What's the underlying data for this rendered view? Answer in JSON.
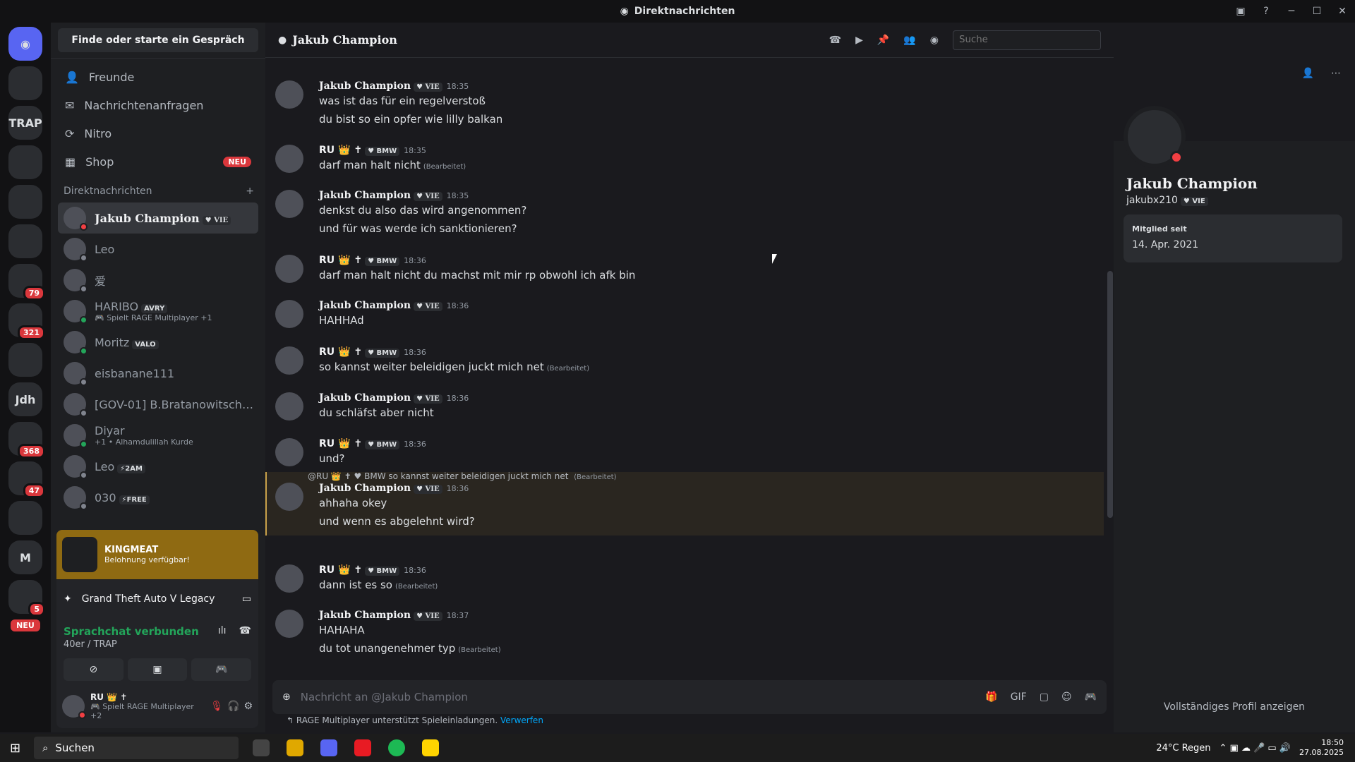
{
  "window": {
    "title": "Direktnachrichten"
  },
  "servers": [
    {
      "label": "",
      "badge": ""
    },
    {
      "label": "TRAP",
      "badge": ""
    },
    {
      "label": "",
      "badge": ""
    },
    {
      "label": "",
      "badge": ""
    },
    {
      "label": "",
      "badge": ""
    },
    {
      "label": "",
      "badge": "79"
    },
    {
      "label": "",
      "badge": "321"
    },
    {
      "label": "",
      "badge": ""
    },
    {
      "label": "Jdh",
      "badge": ""
    },
    {
      "label": "",
      "badge": "368"
    },
    {
      "label": "",
      "badge": "47"
    },
    {
      "label": "",
      "badge": ""
    },
    {
      "label": "M",
      "badge": ""
    },
    {
      "label": "",
      "badge": "5"
    }
  ],
  "servers_neu": "NEU",
  "dm": {
    "search": "Finde oder starte ein Gespräch",
    "nav": [
      {
        "label": "Freunde",
        "icon": "friends-icon"
      },
      {
        "label": "Nachrichtenanfragen",
        "icon": "mail-icon"
      },
      {
        "label": "Nitro",
        "icon": "nitro-icon"
      },
      {
        "label": "Shop",
        "icon": "shop-icon",
        "badge": "NEU"
      }
    ],
    "header": "Direktnachrichten",
    "add": "+",
    "items": [
      {
        "name": "Jakub Champion",
        "tag": "♥ VIE",
        "sub": "",
        "status": "dnd",
        "active": true
      },
      {
        "name": "Leo",
        "tag": "",
        "sub": "",
        "status": "off"
      },
      {
        "name": "爱",
        "tag": "",
        "sub": "",
        "status": "off"
      },
      {
        "name": "HARIBO",
        "tag": "AVRY",
        "sub": "🎮 Spielt RAGE Multiplayer +1",
        "status": "on"
      },
      {
        "name": "Moritz",
        "tag": "VALO",
        "sub": "",
        "status": "on"
      },
      {
        "name": "eisbanane111",
        "tag": "",
        "sub": "",
        "status": "off"
      },
      {
        "name": "[GOV-01] B.Bratanowitsche...",
        "tag": "",
        "sub": "",
        "status": "off"
      },
      {
        "name": "Diyar",
        "tag": "",
        "sub": "+1 • Alhamdulillah Kurde",
        "status": "on"
      },
      {
        "name": "Leo",
        "tag": "⚡2AM",
        "sub": "",
        "status": "off"
      },
      {
        "name": "030",
        "tag": "⚡FREE",
        "sub": "",
        "status": "off"
      }
    ]
  },
  "promo": {
    "title": "KINGMEAT",
    "subtitle": "Belohnung verfügbar!"
  },
  "game": {
    "name": "Grand Theft Auto V Legacy"
  },
  "voice": {
    "status": "Sprachchat verbunden",
    "channel": "40er / TRAP"
  },
  "user": {
    "name": "RU 👑 ✝",
    "status": "🎮 Spielt RAGE Multiplayer +2"
  },
  "channel": {
    "name": "Jakub Champion"
  },
  "search": {
    "placeholder": "Suche"
  },
  "messages": [
    {
      "author": "Jakub Champion",
      "gothic": true,
      "tag": "♥ VIE",
      "time": "18:35",
      "lines": [
        "was ist das für ein regelverstoß",
        "du bist so ein opfer wie lilly balkan"
      ],
      "edited": ""
    },
    {
      "author": "RU 👑 ✝",
      "gothic": false,
      "tag": "♥ BMW",
      "time": "18:35",
      "lines": [
        "darf man halt nicht"
      ],
      "edited": "(Bearbeitet)"
    },
    {
      "author": "Jakub Champion",
      "gothic": true,
      "tag": "♥ VIE",
      "time": "18:35",
      "lines": [
        "denkst du also das wird angenommen?",
        "und für was werde ich sanktionieren?"
      ],
      "edited": ""
    },
    {
      "author": "RU 👑 ✝",
      "gothic": false,
      "tag": "♥ BMW",
      "time": "18:36",
      "lines": [
        "darf man halt nicht du machst mit mir rp obwohl ich afk bin"
      ],
      "edited": ""
    },
    {
      "author": "Jakub Champion",
      "gothic": true,
      "tag": "♥ VIE",
      "time": "18:36",
      "lines": [
        "HAHHAd"
      ],
      "edited": ""
    },
    {
      "author": "RU 👑 ✝",
      "gothic": false,
      "tag": "♥ BMW",
      "time": "18:36",
      "lines": [
        "so kannst weiter beleidigen juckt mich net"
      ],
      "edited": "(Bearbeitet)"
    },
    {
      "author": "Jakub Champion",
      "gothic": true,
      "tag": "♥ VIE",
      "time": "18:36",
      "lines": [
        "du schläfst aber nicht"
      ],
      "edited": ""
    },
    {
      "author": "RU 👑 ✝",
      "gothic": false,
      "tag": "♥ BMW",
      "time": "18:36",
      "lines": [
        "und?"
      ],
      "edited": ""
    },
    {
      "author": "Jakub Champion",
      "gothic": true,
      "tag": "♥ VIE",
      "time": "18:36",
      "lines": [
        "ahhaha okey",
        "und wenn es abgelehnt wird?"
      ],
      "edited": ""
    },
    {
      "author": "RU 👑 ✝",
      "gothic": false,
      "tag": "♥ BMW",
      "time": "18:36",
      "lines": [
        "dann ist es so"
      ],
      "edited": "(Bearbeitet)"
    },
    {
      "author": "Jakub Champion",
      "gothic": true,
      "tag": "♥ VIE",
      "time": "18:37",
      "lines": [
        "HAHAHA",
        "du tot unangenehmer typ"
      ],
      "edited": "(Bearbeitet)"
    }
  ],
  "reply": {
    "text": "@RU 👑 ✝ ♥ BMW so kannst weiter beleidigen juckt mich net",
    "edited": "(Bearbeitet)"
  },
  "composer": {
    "placeholder": "Nachricht an @Jakub Champion"
  },
  "rage_notice": {
    "text": "RAGE Multiplayer unterstützt Spieleinladungen.",
    "link": "Verwerfen"
  },
  "profile": {
    "name": "Jakub Champion",
    "username": "jakubx210",
    "tag": "♥ VIE",
    "member_since_label": "Mitglied seit",
    "member_since": "14. Apr. 2021",
    "full_profile": "Vollständiges Profil anzeigen"
  },
  "taskbar": {
    "search": "Suchen",
    "weather": "24°C Regen",
    "time": "18:50",
    "date": "27.08.2025"
  }
}
